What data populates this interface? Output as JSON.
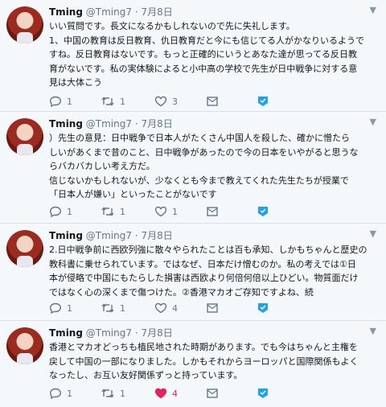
{
  "tweets": [
    {
      "name": "Tming",
      "handle": "@Tming7",
      "separator": "·",
      "date": "7月8日",
      "lines": [
        "いい質問です。長文になるかもしれないので先に失礼します。",
        "1、中国の教育は反日教育、仇日教育だと今にも信じてる人がかなりいるようで",
        "すね。反日教育はないです。もっと正確的にいうとあなた達が思ってる反日教",
        "育がないです。私の実体験によると小中高の学校で先生が日中戦争に対する意",
        "見は大体こう"
      ],
      "replies": "1",
      "retweets": "1",
      "likes": "3",
      "liked": false
    },
    {
      "name": "Tming",
      "handle": "@Tming7",
      "separator": "·",
      "date": "7月8日",
      "lines": [
        "）先生の意見：日中戦争で日本人がたくさん中国人を殺した、確かに憎たら",
        "しいがあくまで昔のこと、日中戦争があったので今の日本をいやがると思うな",
        "らバカバカしい考え方だ。",
        "信じないかもしれないが、少なくとも今まで教えてくれた先生たちが授業で",
        "「日本人が嫌い」といったことがないです"
      ],
      "replies": "1",
      "retweets": "1",
      "likes": "1",
      "liked": false
    },
    {
      "name": "Tming",
      "handle": "@Tming7",
      "separator": "·",
      "date": "7月8日",
      "lines": [
        "2.日中戦争前に西欧列強に散々やられたことは百も承知、しかもちゃんと歴史の",
        "教科書に乗せられています。ではなぜ、日本だけ憎むのか。私の考えでは①日",
        "本が侵略で中国にもたらした損害は西欧より何倍何倍以上ひどい。物質面だけ",
        "ではなく心の深くまで傷つけた。②香港マカオご存知ですよね、続"
      ],
      "replies": "1",
      "retweets": "1",
      "likes": "4",
      "liked": false
    },
    {
      "name": "Tming",
      "handle": "@Tming7",
      "separator": "·",
      "date": "7月8日",
      "lines": [
        "香港とマカオどっちも植民地された時期があります。でも今はちゃんと主権を",
        "戻して中国の一部になりました。しかもそれからヨーロッパと国際関係もよく",
        "なったし、お互い友好関係ずっと持っています。"
      ],
      "replies": "1",
      "retweets": "1",
      "likes": "4",
      "liked": true
    }
  ],
  "colors": {
    "accent": "#1da1f2",
    "like": "#e0245e",
    "muted": "#657786"
  },
  "icons": [
    "reply-icon",
    "retweet-icon",
    "like-icon",
    "message-icon",
    "dm-verify-icon",
    "chevron-down-icon"
  ]
}
